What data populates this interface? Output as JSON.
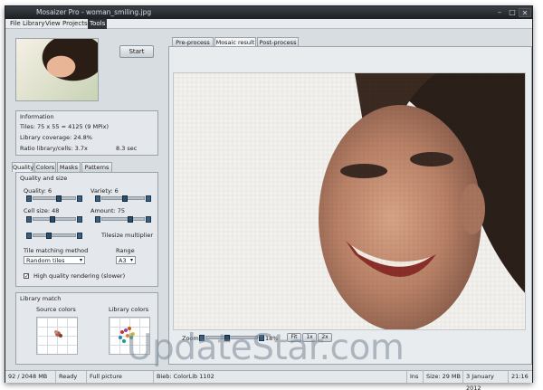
{
  "window": {
    "title": "Mosaizer Pro - woman_smiling.jpg",
    "minimize": "–",
    "maximize": "□",
    "close": "✕"
  },
  "menu": [
    "File",
    "Library",
    "View",
    "Projects",
    "Tools"
  ],
  "start_label": "Start",
  "info": {
    "title": "Information",
    "tiles": "Tiles: 75 x 55 = 4125 (9 MPix)",
    "coverage": "Library coverage: 24.8%",
    "ratio": "Ratio library/cells: 3.7x",
    "time": "8.3 sec"
  },
  "left_tabs": [
    "Quality",
    "Colors",
    "Masks",
    "Patterns"
  ],
  "quality": {
    "title": "Quality and size",
    "quality_label": "Quality: 6",
    "quality_level": 0.62,
    "variety_label": "Variety: 6",
    "variety_level": 0.55,
    "cellsize_label": "Cell size: 48",
    "cellsize_level": 0.45,
    "amount_label": "Amount: 75",
    "amount_level": 0.7,
    "tilesize_label": "Tilesize multiplier",
    "tilesize_level": 0.35,
    "method_label": "Tile matching method",
    "method_value": "Random tiles",
    "range_label": "Range",
    "range_value": "A3",
    "hq_label": "High quality rendering (slower)",
    "hq_checked": "✓"
  },
  "library_match": {
    "title": "Library match",
    "source": "Source colors",
    "library": "Library colors"
  },
  "right_tabs": [
    "Pre-process",
    "Mosaic result",
    "Post-process"
  ],
  "zoom": {
    "label": "Zoom:",
    "value": "18%",
    "fit": "Fit",
    "x1": "1x",
    "x2": "2x"
  },
  "status": {
    "memory": "92 / 2048 MB",
    "state": "Ready",
    "view": "Full picture",
    "library": "Bieb: ColorLib 1102",
    "ins": "Ins",
    "size": "Size: 29 MB",
    "date": "3 January 2012",
    "time": "21:16"
  },
  "watermark": "UpdateStar.com"
}
